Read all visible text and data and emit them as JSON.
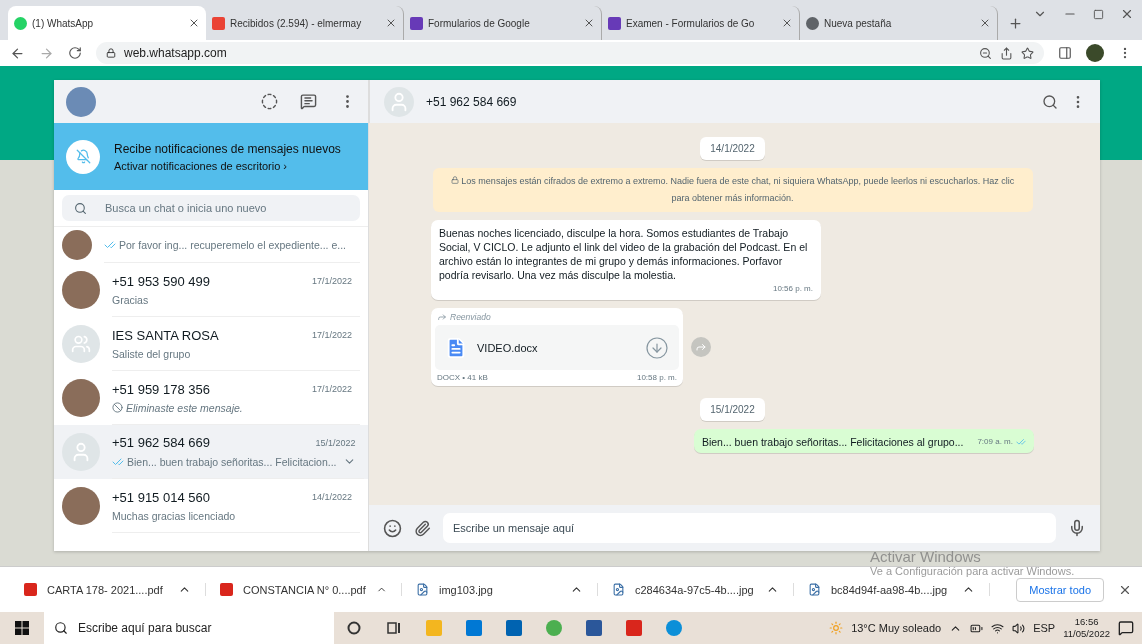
{
  "browser": {
    "tabs": [
      {
        "title": "(1) WhatsApp",
        "kind": "whatsapp",
        "selected": true
      },
      {
        "title": "Recibidos (2.594) - elmermay",
        "kind": "gmail",
        "selected": false
      },
      {
        "title": "Formularios de Google",
        "kind": "forms",
        "selected": false
      },
      {
        "title": "Examen - Formularios de Go",
        "kind": "forms",
        "selected": false
      },
      {
        "title": "Nueva pestaña",
        "kind": "chrome",
        "selected": false
      }
    ],
    "url": "web.whatsapp.com"
  },
  "sidebar": {
    "notification": {
      "title": "Recibe notificaciones de mensajes nuevos",
      "link": "Activar notificaciones de escritorio ›"
    },
    "search": {
      "placeholder": "Busca un chat o inicia uno nuevo"
    },
    "chats": [
      {
        "preview": "Por favor ing... recuperemelo el expediente... e...",
        "kind": "read",
        "avatar": {
          "kind": "photo"
        },
        "selected": false
      },
      {
        "name": "+51 953 590 499",
        "date": "17/1/2022",
        "preview": "Gracias",
        "kind": "plain",
        "avatar": {
          "kind": "photo"
        },
        "selected": false
      },
      {
        "name": "IES SANTA ROSA",
        "date": "17/1/2022",
        "preview": "Saliste del grupo",
        "kind": "plain",
        "avatar": {
          "kind": "group"
        },
        "selected": false
      },
      {
        "name": "+51 959 178 356",
        "date": "17/1/2022",
        "preview": "Eliminaste este mensaje.",
        "kind": "deleted",
        "avatar": {
          "kind": "photo"
        },
        "selected": false
      },
      {
        "name": "+51 962 584 669",
        "date": "15/1/2022",
        "preview": "Bien... buen trabajo señoritas... Felicitacion...",
        "kind": "read",
        "avatar": {
          "kind": "person"
        },
        "selected": true
      },
      {
        "name": "+51 915 014 560",
        "date": "14/1/2022",
        "preview": "Muchas gracias licenciado",
        "kind": "plain",
        "avatar": {
          "kind": "photo"
        },
        "selected": false
      }
    ]
  },
  "conversation": {
    "contact": "+51 962 584 669",
    "messages": [
      {
        "kind": "date",
        "text": "14/1/2022"
      },
      {
        "kind": "system",
        "text": "Los mensajes están cifrados de extremo a extremo. Nadie fuera de este chat, ni siquiera WhatsApp, puede leerlos ni escucharlos. Haz clic para obtener más información."
      },
      {
        "kind": "incoming",
        "text": "Buenas noches licenciado, disculpe la hora. Somos estudiantes de Trabajo Social, V CICLO. Le adjunto el link del video de la grabación del Podcast. En el archivo están lo integrantes de mi grupo y demás informaciones. Porfavor podría revisarlo. Una vez más disculpe la molestia.",
        "time": "10:56 p. m."
      },
      {
        "kind": "file",
        "forwarded": "Reenviado",
        "filename": "VIDEO.docx",
        "meta": "DOCX • 41 kB",
        "time": "10:58 p. m."
      },
      {
        "kind": "date",
        "text": "15/1/2022"
      },
      {
        "kind": "outgoing",
        "text": "Bien... buen trabajo señoritas... Felicitaciones al grupo...",
        "time": "7:09 a. m."
      }
    ],
    "composer": {
      "placeholder": "Escribe un mensaje aquí"
    }
  },
  "activation": {
    "title": "Activar Windows",
    "subtitle": "Ve a Configuración para activar Windows."
  },
  "downloads": {
    "items": [
      {
        "name": "CARTA 178- 2021....pdf",
        "kind": "pdf"
      },
      {
        "name": "CONSTANCIA N° 0....pdf",
        "kind": "pdf"
      },
      {
        "name": "img103.jpg",
        "kind": "file"
      },
      {
        "name": "c284634a-97c5-4b....jpg",
        "kind": "file"
      },
      {
        "name": "bc84d94f-aa98-4b....jpg",
        "kind": "file"
      }
    ],
    "show_all": "Mostrar todo"
  },
  "taskbar": {
    "search": {
      "placeholder": "Escribe aquí para buscar"
    },
    "apps": [
      {
        "kind": "cortana"
      },
      {
        "kind": "taskview"
      },
      {
        "kind": "explorer"
      },
      {
        "kind": "mail"
      },
      {
        "kind": "store"
      },
      {
        "kind": "chrome"
      },
      {
        "kind": "word"
      },
      {
        "kind": "acrobat"
      },
      {
        "kind": "edge"
      }
    ],
    "weather": "13°C  Muy soleado",
    "language": "ESP",
    "time": "16:56",
    "date": "11/05/2022"
  }
}
